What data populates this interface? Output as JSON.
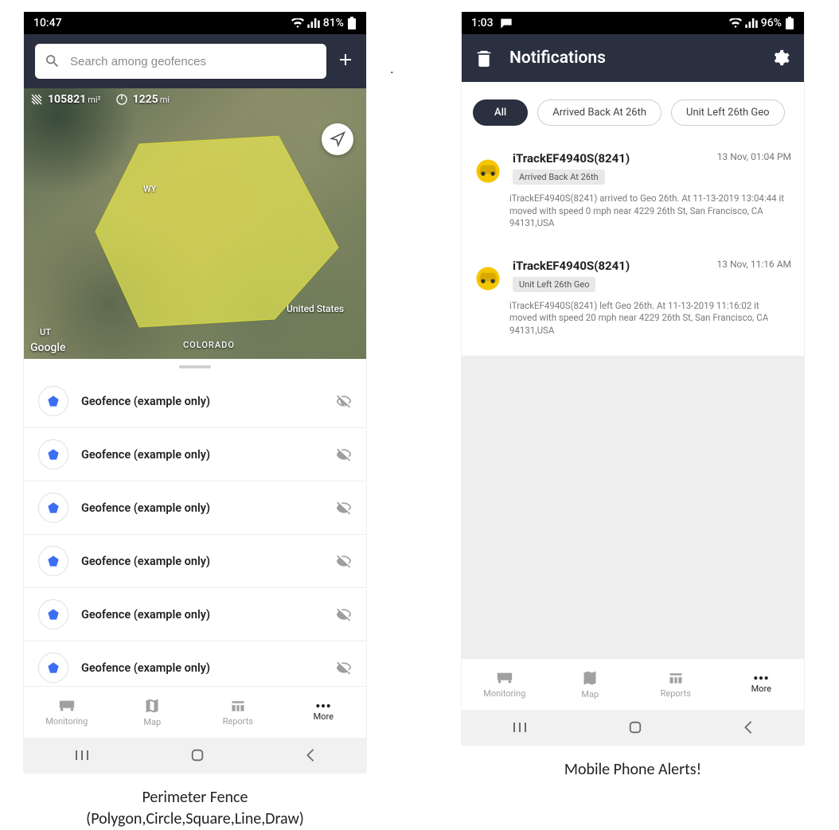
{
  "phone1": {
    "status": {
      "time": "10:47",
      "battery": "81%"
    },
    "search": {
      "placeholder": "Search among geofences"
    },
    "map": {
      "area_val": "105821",
      "area_unit": "mi²",
      "perim_val": "1225",
      "perim_unit": "mi",
      "label_wy": "WY",
      "label_ut": "UT",
      "label_co": "COLORADO",
      "label_us": "United States",
      "google": "Google"
    },
    "geofences": [
      {
        "label": "Geofence (example only)"
      },
      {
        "label": "Geofence (example only)"
      },
      {
        "label": "Geofence (example only)"
      },
      {
        "label": "Geofence (example only)"
      },
      {
        "label": "Geofence (example only)"
      },
      {
        "label": "Geofence (example only)"
      }
    ],
    "nav": {
      "monitoring": "Monitoring",
      "map": "Map",
      "reports": "Reports",
      "more": "More"
    },
    "caption_line1": "Perimeter Fence",
    "caption_line2": "(Polygon,Circle,Square,Line,Draw)"
  },
  "phone2": {
    "status": {
      "time": "1:03",
      "battery": "96%"
    },
    "header": {
      "title": "Notifications"
    },
    "filters": {
      "all": "All",
      "f1": "Arrived Back At 26th",
      "f2": "Unit Left 26th Geo"
    },
    "n1": {
      "title": "iTrackEF4940S(8241)",
      "time": "13 Nov, 01:04 PM",
      "tag": "Arrived Back At 26th",
      "desc": "iTrackEF4940S(8241) arrived to Geo 26th.     At 11-13-2019 13:04:44 it moved with speed 0 mph near 4229 26th St, San Francisco, CA 94131,USA"
    },
    "n2": {
      "title": "iTrackEF4940S(8241)",
      "time": "13 Nov, 11:16 AM",
      "tag": "Unit Left 26th Geo",
      "desc": "iTrackEF4940S(8241) left Geo 26th.     At 11-13-2019 11:16:02 it moved with speed 20 mph near 4229 26th St, San Francisco, CA 94131,USA"
    },
    "nav": {
      "monitoring": "Monitoring",
      "map": "Map",
      "reports": "Reports",
      "more": "More"
    },
    "caption": "Mobile Phone Alerts!"
  }
}
